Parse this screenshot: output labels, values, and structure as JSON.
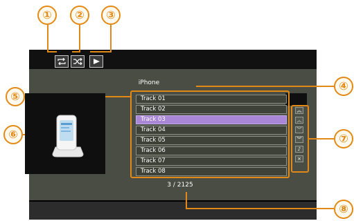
{
  "callouts": [
    "①",
    "②",
    "③",
    "④",
    "⑤",
    "⑥",
    "⑦",
    "⑧"
  ],
  "toolbar": {
    "repeat": {
      "icon": "repeat-icon"
    },
    "shuffle": {
      "icon": "shuffle-icon"
    },
    "play": {
      "icon": "play-icon"
    }
  },
  "device": {
    "name": "iPhone",
    "icon": "iphone-dock-icon"
  },
  "tracks": [
    {
      "label": "Track 01",
      "selected": false
    },
    {
      "label": "Track 02",
      "selected": false
    },
    {
      "label": "Track 03",
      "selected": true
    },
    {
      "label": "Track 04",
      "selected": false
    },
    {
      "label": "Track 05",
      "selected": false
    },
    {
      "label": "Track 06",
      "selected": false
    },
    {
      "label": "Track 07",
      "selected": false
    },
    {
      "label": "Track 08",
      "selected": false
    }
  ],
  "scroll_buttons": [
    {
      "name": "scroll-top-button",
      "icon": "double-chevron-up-icon",
      "glyph": "︽"
    },
    {
      "name": "scroll-up-button",
      "icon": "chevron-up-icon",
      "glyph": "︿"
    },
    {
      "name": "scroll-down-button",
      "icon": "chevron-down-icon",
      "glyph": "﹀"
    },
    {
      "name": "scroll-bottom-button",
      "icon": "double-chevron-down-icon",
      "glyph": "︾"
    },
    {
      "name": "music-note-button",
      "icon": "music-note-icon",
      "glyph": "♪"
    },
    {
      "name": "close-list-button",
      "icon": "close-icon",
      "glyph": "×"
    }
  ],
  "counter": "3 / 2125",
  "colors": {
    "callout": "#e38a16",
    "selected_track": "#a987d6",
    "panel": "#4a4d44"
  }
}
